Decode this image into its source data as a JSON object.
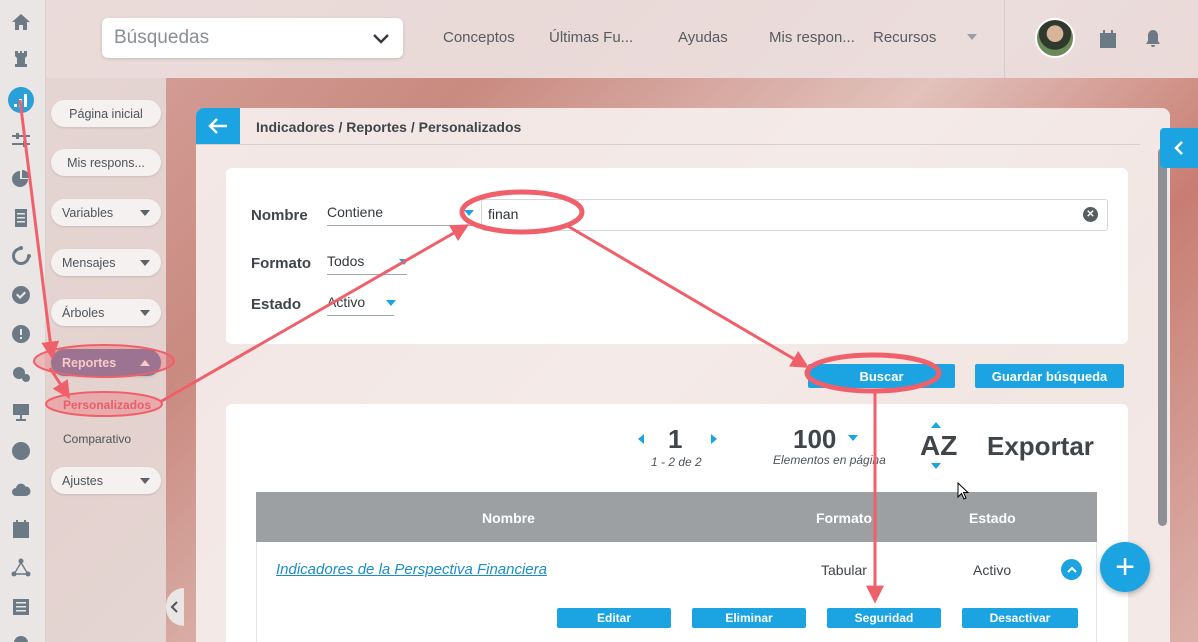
{
  "topbar": {
    "search_placeholder": "Búsquedas",
    "nav": [
      "Conceptos",
      "Últimas Fu...",
      "Ayudas",
      "Mis respon...",
      "Recursos"
    ]
  },
  "sidebar": {
    "items": [
      {
        "label": "Página inicial"
      },
      {
        "label": "Mis respons..."
      },
      {
        "label": "Variables"
      },
      {
        "label": "Mensajes"
      },
      {
        "label": "Árboles"
      },
      {
        "label": "Reportes"
      },
      {
        "label": "Personalizados"
      },
      {
        "label": "Comparativo"
      },
      {
        "label": "Ajustes"
      }
    ]
  },
  "breadcrumb": "Indicadores / Reportes / Personalizados",
  "filters": {
    "nombre_label": "Nombre",
    "nombre_op": "Contiene",
    "nombre_value": "finan",
    "formato_label": "Formato",
    "formato_value": "Todos",
    "estado_label": "Estado",
    "estado_value": "Activo"
  },
  "actions": {
    "buscar": "Buscar",
    "guardar": "Guardar búsqueda"
  },
  "pager": {
    "page": "1",
    "range": "1 - 2 de 2",
    "per_page": "100",
    "per_page_label": "Elementos en página",
    "sort": "AZ",
    "export": "Exportar"
  },
  "table": {
    "headers": [
      "Nombre",
      "Formato",
      "Estado"
    ],
    "rows": [
      {
        "nombre": "Indicadores de la Perspectiva Financiera",
        "formato": "Tabular",
        "estado": "Activo"
      }
    ],
    "row_actions": [
      "Editar",
      "Eliminar",
      "Seguridad",
      "Desactivar"
    ]
  },
  "colors": {
    "accent": "#1ba4e1",
    "annotation": "#f0606a"
  }
}
